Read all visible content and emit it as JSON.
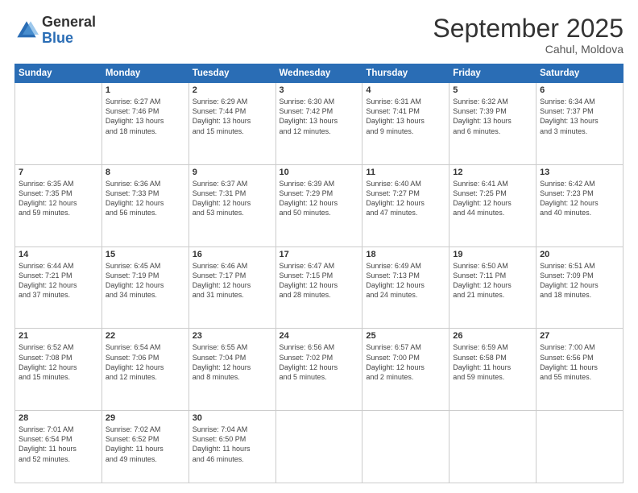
{
  "logo": {
    "general": "General",
    "blue": "Blue"
  },
  "header": {
    "month": "September 2025",
    "location": "Cahul, Moldova"
  },
  "days_of_week": [
    "Sunday",
    "Monday",
    "Tuesday",
    "Wednesday",
    "Thursday",
    "Friday",
    "Saturday"
  ],
  "weeks": [
    [
      {
        "day": "",
        "info": ""
      },
      {
        "day": "1",
        "info": "Sunrise: 6:27 AM\nSunset: 7:46 PM\nDaylight: 13 hours\nand 18 minutes."
      },
      {
        "day": "2",
        "info": "Sunrise: 6:29 AM\nSunset: 7:44 PM\nDaylight: 13 hours\nand 15 minutes."
      },
      {
        "day": "3",
        "info": "Sunrise: 6:30 AM\nSunset: 7:42 PM\nDaylight: 13 hours\nand 12 minutes."
      },
      {
        "day": "4",
        "info": "Sunrise: 6:31 AM\nSunset: 7:41 PM\nDaylight: 13 hours\nand 9 minutes."
      },
      {
        "day": "5",
        "info": "Sunrise: 6:32 AM\nSunset: 7:39 PM\nDaylight: 13 hours\nand 6 minutes."
      },
      {
        "day": "6",
        "info": "Sunrise: 6:34 AM\nSunset: 7:37 PM\nDaylight: 13 hours\nand 3 minutes."
      }
    ],
    [
      {
        "day": "7",
        "info": "Sunrise: 6:35 AM\nSunset: 7:35 PM\nDaylight: 12 hours\nand 59 minutes."
      },
      {
        "day": "8",
        "info": "Sunrise: 6:36 AM\nSunset: 7:33 PM\nDaylight: 12 hours\nand 56 minutes."
      },
      {
        "day": "9",
        "info": "Sunrise: 6:37 AM\nSunset: 7:31 PM\nDaylight: 12 hours\nand 53 minutes."
      },
      {
        "day": "10",
        "info": "Sunrise: 6:39 AM\nSunset: 7:29 PM\nDaylight: 12 hours\nand 50 minutes."
      },
      {
        "day": "11",
        "info": "Sunrise: 6:40 AM\nSunset: 7:27 PM\nDaylight: 12 hours\nand 47 minutes."
      },
      {
        "day": "12",
        "info": "Sunrise: 6:41 AM\nSunset: 7:25 PM\nDaylight: 12 hours\nand 44 minutes."
      },
      {
        "day": "13",
        "info": "Sunrise: 6:42 AM\nSunset: 7:23 PM\nDaylight: 12 hours\nand 40 minutes."
      }
    ],
    [
      {
        "day": "14",
        "info": "Sunrise: 6:44 AM\nSunset: 7:21 PM\nDaylight: 12 hours\nand 37 minutes."
      },
      {
        "day": "15",
        "info": "Sunrise: 6:45 AM\nSunset: 7:19 PM\nDaylight: 12 hours\nand 34 minutes."
      },
      {
        "day": "16",
        "info": "Sunrise: 6:46 AM\nSunset: 7:17 PM\nDaylight: 12 hours\nand 31 minutes."
      },
      {
        "day": "17",
        "info": "Sunrise: 6:47 AM\nSunset: 7:15 PM\nDaylight: 12 hours\nand 28 minutes."
      },
      {
        "day": "18",
        "info": "Sunrise: 6:49 AM\nSunset: 7:13 PM\nDaylight: 12 hours\nand 24 minutes."
      },
      {
        "day": "19",
        "info": "Sunrise: 6:50 AM\nSunset: 7:11 PM\nDaylight: 12 hours\nand 21 minutes."
      },
      {
        "day": "20",
        "info": "Sunrise: 6:51 AM\nSunset: 7:09 PM\nDaylight: 12 hours\nand 18 minutes."
      }
    ],
    [
      {
        "day": "21",
        "info": "Sunrise: 6:52 AM\nSunset: 7:08 PM\nDaylight: 12 hours\nand 15 minutes."
      },
      {
        "day": "22",
        "info": "Sunrise: 6:54 AM\nSunset: 7:06 PM\nDaylight: 12 hours\nand 12 minutes."
      },
      {
        "day": "23",
        "info": "Sunrise: 6:55 AM\nSunset: 7:04 PM\nDaylight: 12 hours\nand 8 minutes."
      },
      {
        "day": "24",
        "info": "Sunrise: 6:56 AM\nSunset: 7:02 PM\nDaylight: 12 hours\nand 5 minutes."
      },
      {
        "day": "25",
        "info": "Sunrise: 6:57 AM\nSunset: 7:00 PM\nDaylight: 12 hours\nand 2 minutes."
      },
      {
        "day": "26",
        "info": "Sunrise: 6:59 AM\nSunset: 6:58 PM\nDaylight: 11 hours\nand 59 minutes."
      },
      {
        "day": "27",
        "info": "Sunrise: 7:00 AM\nSunset: 6:56 PM\nDaylight: 11 hours\nand 55 minutes."
      }
    ],
    [
      {
        "day": "28",
        "info": "Sunrise: 7:01 AM\nSunset: 6:54 PM\nDaylight: 11 hours\nand 52 minutes."
      },
      {
        "day": "29",
        "info": "Sunrise: 7:02 AM\nSunset: 6:52 PM\nDaylight: 11 hours\nand 49 minutes."
      },
      {
        "day": "30",
        "info": "Sunrise: 7:04 AM\nSunset: 6:50 PM\nDaylight: 11 hours\nand 46 minutes."
      },
      {
        "day": "",
        "info": ""
      },
      {
        "day": "",
        "info": ""
      },
      {
        "day": "",
        "info": ""
      },
      {
        "day": "",
        "info": ""
      }
    ]
  ]
}
